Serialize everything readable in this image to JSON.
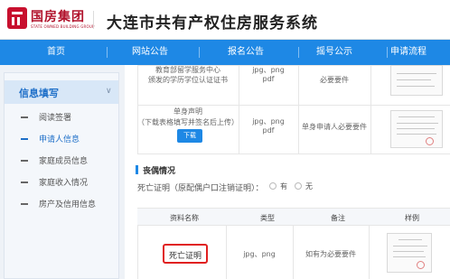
{
  "brand": {
    "logo_text": "国房集团",
    "logo_sub": "STATE OWNED BUILDING GROUP",
    "system_title": "大连市共有产权住房服务系统"
  },
  "nav": {
    "items": [
      "首页",
      "网站公告",
      "报名公告",
      "摇号公示",
      "申请流程"
    ]
  },
  "sidebar": {
    "section_label": "信息填写",
    "items": [
      {
        "label": "阅读签署",
        "active": false
      },
      {
        "label": "申请人信息",
        "active": true
      },
      {
        "label": "家庭成员信息",
        "active": false
      },
      {
        "label": "家庭收入情况",
        "active": false
      },
      {
        "label": "房产及信用信息",
        "active": false
      }
    ]
  },
  "upper_table": {
    "rows": [
      {
        "name_lines": [
          "教育部留学服务中心",
          "颁发的学历学位认证证书"
        ],
        "type_lines": [
          "jpg、png",
          "pdf"
        ],
        "note": "必要要件"
      },
      {
        "name_lines": [
          "单身声明",
          "（下载表格填写并签名后上传）"
        ],
        "type_lines": [
          "jpg、png",
          "pdf"
        ],
        "note": "单身申请人必要要件",
        "download_label": "下载"
      }
    ]
  },
  "widowed": {
    "title": "丧偶情况",
    "question": "死亡证明（原配偶户口注销证明）：",
    "options": [
      "有",
      "无"
    ]
  },
  "lower_table": {
    "headers": [
      "资料名称",
      "类型",
      "备注",
      "样例"
    ],
    "row": {
      "name": "死亡证明",
      "type": "jpg、png",
      "note": "如有为必要要件"
    }
  },
  "colors": {
    "nav_blue": "#1e88e5",
    "brand_red": "#c8102e",
    "highlight_red": "#e02020"
  }
}
